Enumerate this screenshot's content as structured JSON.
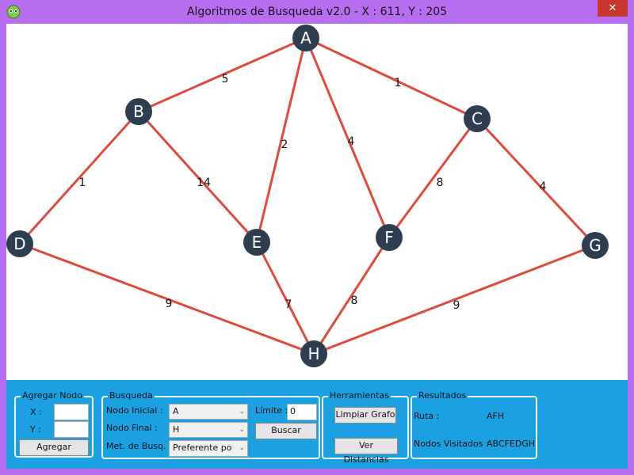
{
  "window": {
    "title": "Algoritmos de Busqueda v2.0  -  X : 611,  Y : 205",
    "close_label": "✕"
  },
  "graph": {
    "node_color": "#2d3e50",
    "edge_color": "#e04a3a",
    "nodes": [
      {
        "id": "A"
      },
      {
        "id": "B"
      },
      {
        "id": "C"
      },
      {
        "id": "D"
      },
      {
        "id": "E"
      },
      {
        "id": "F"
      },
      {
        "id": "G"
      },
      {
        "id": "H"
      }
    ],
    "edges": [
      {
        "from": "A",
        "to": "B",
        "weight": "5"
      },
      {
        "from": "A",
        "to": "C",
        "weight": "1"
      },
      {
        "from": "A",
        "to": "E",
        "weight": "2"
      },
      {
        "from": "A",
        "to": "F",
        "weight": "4"
      },
      {
        "from": "B",
        "to": "D",
        "weight": "1"
      },
      {
        "from": "B",
        "to": "E",
        "weight": "14"
      },
      {
        "from": "C",
        "to": "F",
        "weight": "8"
      },
      {
        "from": "C",
        "to": "G",
        "weight": "4"
      },
      {
        "from": "D",
        "to": "H",
        "weight": "9"
      },
      {
        "from": "E",
        "to": "H",
        "weight": "7"
      },
      {
        "from": "F",
        "to": "H",
        "weight": "8"
      },
      {
        "from": "G",
        "to": "H",
        "weight": "9"
      }
    ]
  },
  "agregar_nodo": {
    "legend": "Agregar Nodo",
    "x_label": "X :",
    "y_label": "Y :",
    "x_value": "",
    "y_value": "",
    "button": "Agregar"
  },
  "busqueda": {
    "legend": "Busqueda",
    "nodo_inicial_label": "Nodo Inicial :",
    "nodo_inicial_value": "A",
    "nodo_final_label": "Nodo Final :",
    "nodo_final_value": "H",
    "metodo_label": "Met. de Busq. :",
    "metodo_value": "Preferente po",
    "limite_label": "Límite :",
    "limite_value": "0",
    "buscar_button": "Buscar"
  },
  "herramientas": {
    "legend": "Herramientas",
    "limpiar_button": "Limpiar Grafo",
    "distancias_button": "Ver Distancias"
  },
  "resultados": {
    "legend": "Resultados",
    "ruta_label": "Ruta :",
    "ruta_value": "AFH",
    "visitados_label": "Nodos Visitados :",
    "visitados_value": "ABCFEDGH"
  }
}
